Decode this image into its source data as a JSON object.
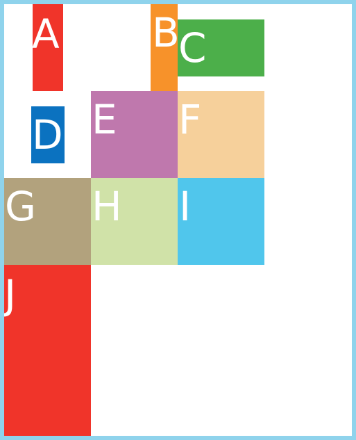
{
  "blocks": [
    {
      "id": "a",
      "label": "A",
      "color": "#f0342a"
    },
    {
      "id": "b",
      "label": "B",
      "color": "#f7922a"
    },
    {
      "id": "c",
      "label": "C",
      "color": "#4caf4a"
    },
    {
      "id": "d",
      "label": "D",
      "color": "#0b72c0"
    },
    {
      "id": "e",
      "label": "E",
      "color": "#bf78ad"
    },
    {
      "id": "f",
      "label": "F",
      "color": "#f6d09b"
    },
    {
      "id": "g",
      "label": "G",
      "color": "#b2a27d"
    },
    {
      "id": "h",
      "label": "H",
      "color": "#d0e2a8"
    },
    {
      "id": "i",
      "label": "I",
      "color": "#50c6ec"
    },
    {
      "id": "j",
      "label": "J",
      "color": "#f0342a"
    }
  ],
  "frame": {
    "border_color": "#8fd3ec",
    "background": "#ffffff"
  }
}
